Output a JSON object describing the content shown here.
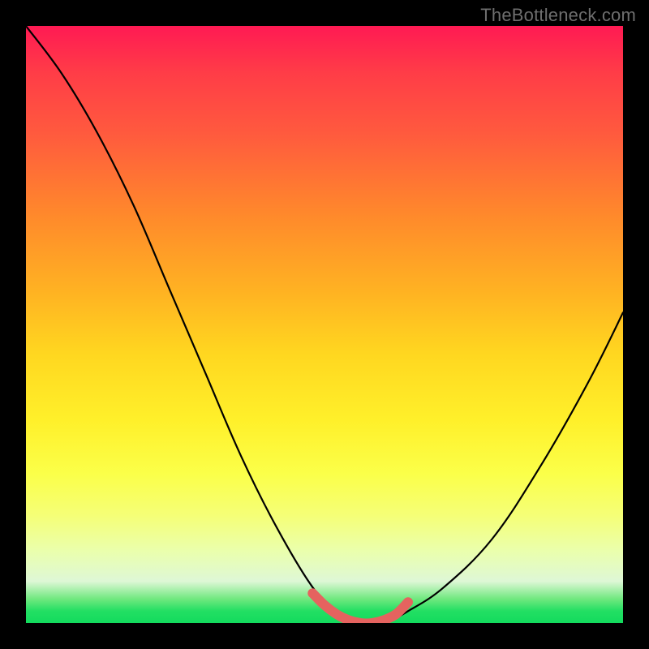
{
  "watermark": {
    "text": "TheBottleneck.com"
  },
  "colors": {
    "curve": "#000000",
    "marker": "#e5635f",
    "frame": "#000000"
  },
  "chart_data": {
    "type": "line",
    "title": "",
    "xlabel": "",
    "ylabel": "",
    "xlim": [
      0,
      100
    ],
    "ylim": [
      0,
      100
    ],
    "grid": false,
    "legend": false,
    "x": [
      0,
      6,
      12,
      18,
      24,
      30,
      36,
      42,
      48,
      52,
      56,
      60,
      64,
      70,
      78,
      86,
      94,
      100
    ],
    "values": [
      100,
      92,
      82,
      70,
      56,
      42,
      28,
      16,
      6,
      2,
      0,
      0,
      2,
      6,
      14,
      26,
      40,
      52
    ],
    "series": [
      {
        "name": "bottleneck-curve",
        "x": [
          0,
          6,
          12,
          18,
          24,
          30,
          36,
          42,
          48,
          52,
          56,
          60,
          64,
          70,
          78,
          86,
          94,
          100
        ],
        "values": [
          100,
          92,
          82,
          70,
          56,
          42,
          28,
          16,
          6,
          2,
          0,
          0,
          2,
          6,
          14,
          26,
          40,
          52
        ]
      },
      {
        "name": "sweet-spot-marker",
        "x": [
          48,
          50,
          52,
          54,
          56,
          58,
          60,
          62,
          64
        ],
        "values": [
          5,
          3,
          1.5,
          0.5,
          0,
          0,
          0.5,
          1.5,
          3.5
        ]
      }
    ]
  }
}
